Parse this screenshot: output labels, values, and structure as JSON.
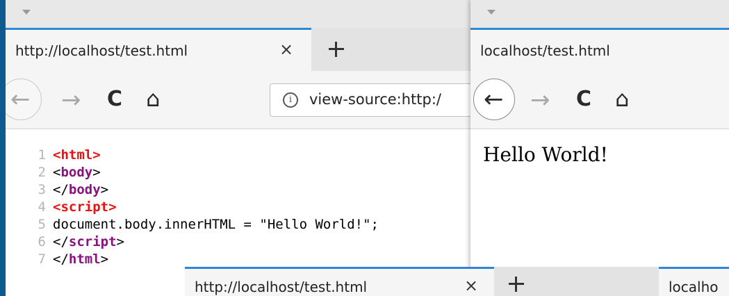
{
  "left_window": {
    "tab_title": "http://localhost/test.html",
    "tab_close": "×",
    "url": "view-source:http:/",
    "info_icon": "i",
    "nav": {
      "back": "←",
      "forward": "→",
      "reload": "C",
      "home": "⌂"
    },
    "source_lines": [
      {
        "num": "1",
        "parts": [
          {
            "t": "<",
            "c": "tag-red"
          },
          {
            "t": "html",
            "c": "tag-red"
          },
          {
            "t": ">",
            "c": "tag-red"
          }
        ]
      },
      {
        "num": "2",
        "parts": [
          {
            "t": "<",
            "c": "punc"
          },
          {
            "t": "body",
            "c": "tag-purple"
          },
          {
            "t": ">",
            "c": "punc"
          }
        ]
      },
      {
        "num": "3",
        "parts": [
          {
            "t": "</",
            "c": "punc"
          },
          {
            "t": "body",
            "c": "tag-purple"
          },
          {
            "t": ">",
            "c": "punc"
          }
        ]
      },
      {
        "num": "4",
        "parts": [
          {
            "t": "<",
            "c": "tag-red"
          },
          {
            "t": "script",
            "c": "tag-red"
          },
          {
            "t": ">",
            "c": "tag-red"
          }
        ]
      },
      {
        "num": "5",
        "parts": [
          {
            "t": "document.body.innerHTML = \"Hello World!\";",
            "c": "code-text"
          }
        ]
      },
      {
        "num": "6",
        "parts": [
          {
            "t": "</",
            "c": "punc"
          },
          {
            "t": "script",
            "c": "tag-purple"
          },
          {
            "t": ">",
            "c": "punc"
          }
        ]
      },
      {
        "num": "7",
        "parts": [
          {
            "t": "</",
            "c": "punc"
          },
          {
            "t": "html",
            "c": "tag-purple"
          },
          {
            "t": ">",
            "c": "punc"
          }
        ]
      }
    ]
  },
  "right_window": {
    "tab_title": "localhost/test.html",
    "nav": {
      "back": "←",
      "forward": "→",
      "reload": "C",
      "home": "⌂"
    },
    "page_text": "Hello World!"
  },
  "bottom_window": {
    "tab_title": "http://localhost/test.html",
    "tab_close": "×",
    "tab2_title": "localho"
  },
  "colors": {
    "desktop": "#0d5a8e",
    "tab_accent": "#2f86d6",
    "tag_red": "#ee1010",
    "tag_purple": "#881280"
  }
}
